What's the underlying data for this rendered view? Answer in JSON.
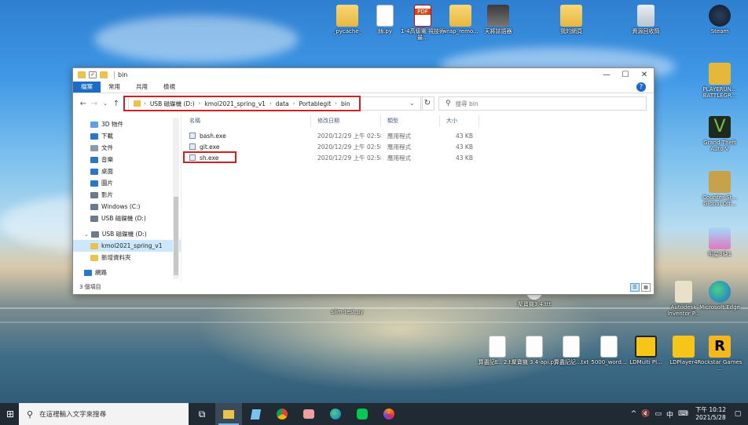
{
  "desktop": {
    "icons_top": [
      "_pycache_",
      "絲.py",
      "1-4高級電 視技術最...",
      "wrap_remo...",
      "天將誌語器",
      "我的網頁",
      "資源回收筒",
      "Steam"
    ],
    "icons_right": [
      "PLAYERUN... BATTLEGR...",
      "Grand Theft Auto V",
      "Counter-St... Global Off...",
      "明星3缺1"
    ],
    "icons_bottom_mid": [
      "slim-test.py",
      "聚寶機3.4.ttt"
    ],
    "icons_bottom": [
      "算盡記E.. 2.txt",
      "聚寶機 3.4-api.py",
      "算盡記記...txt",
      "5000_word...",
      "LDMulti Pl...",
      "LDPlayer4",
      "Rockstar Games ..."
    ],
    "icons_right_low": [
      "Autodesk Inventor P...",
      "Microsoft Edge"
    ]
  },
  "window": {
    "title": "bin",
    "tabs": [
      "檔案",
      "常用",
      "共用",
      "檢視"
    ],
    "address": {
      "crumbs": [
        "USB 磁碟機 (D:)",
        "kmol2021_spring_v1",
        "data",
        "Portablegit",
        "bin"
      ]
    },
    "search_placeholder": "搜尋 bin",
    "nav": [
      {
        "label": "3D 物件",
        "icon": "cube-icon",
        "color": "#5ea0e6"
      },
      {
        "label": "下載",
        "icon": "download-icon",
        "color": "#2a77c9"
      },
      {
        "label": "文件",
        "icon": "document-icon",
        "color": "#8a9bb0"
      },
      {
        "label": "音樂",
        "icon": "music-icon",
        "color": "#2a77c9"
      },
      {
        "label": "桌面",
        "icon": "desktop-icon",
        "color": "#2a77c9"
      },
      {
        "label": "圖片",
        "icon": "picture-icon",
        "color": "#2a77c9"
      },
      {
        "label": "影片",
        "icon": "video-icon",
        "color": "#6b7a8c"
      },
      {
        "label": "Windows (C:)",
        "icon": "drive-icon",
        "color": "#6b7a8c"
      },
      {
        "label": "USB 磁碟機 (D:)",
        "icon": "usb-drive-icon",
        "color": "#6b7a8c"
      },
      {
        "label": "USB 磁碟機 (D:)",
        "icon": "usb-drive-icon",
        "color": "#6b7a8c"
      },
      {
        "label": "kmol2021_spring_v1",
        "icon": "folder-icon",
        "color": "#e9c34d"
      },
      {
        "label": "新增資料夾",
        "icon": "folder-icon",
        "color": "#e9c34d"
      },
      {
        "label": "網路",
        "icon": "network-icon",
        "color": "#2a77c9"
      }
    ],
    "columns": [
      "名稱",
      "修改日期",
      "類型",
      "大小"
    ],
    "files": [
      {
        "name": "bash.exe",
        "date": "2020/12/29 上午 02:58",
        "type": "應用程式",
        "size": "43 KB"
      },
      {
        "name": "git.exe",
        "date": "2020/12/29 上午 02:58",
        "type": "應用程式",
        "size": "43 KB"
      },
      {
        "name": "sh.exe",
        "date": "2020/12/29 上午 02:58",
        "type": "應用程式",
        "size": "43 KB"
      }
    ],
    "status": "3 個項目"
  },
  "taskbar": {
    "search_placeholder": "在這裡輸入文字來搜尋",
    "time": "下午 10:12",
    "date": "2021/5/28"
  }
}
